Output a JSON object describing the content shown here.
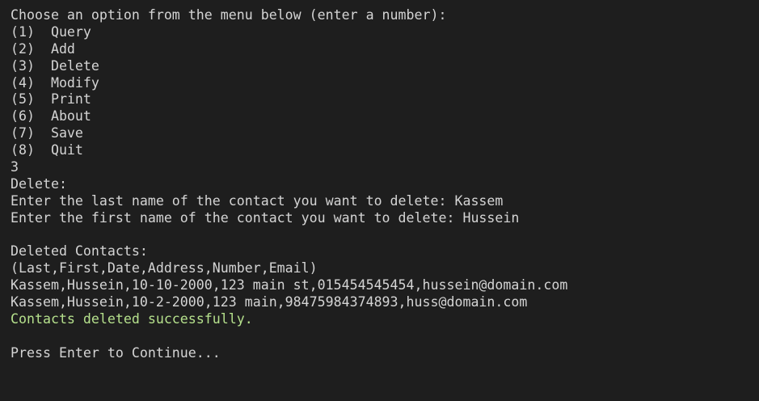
{
  "terminal": {
    "menu_prompt": "Choose an option from the menu below (enter a number):",
    "menu_items": [
      "(1)  Query",
      "(2)  Add",
      "(3)  Delete",
      "(4)  Modify",
      "(5)  Print",
      "(6)  About",
      "(7)  Save",
      "(8)  Quit"
    ],
    "user_choice": "3",
    "delete_header": "Delete:",
    "last_name_prompt": "Enter the last name of the contact you want to delete: Kassem",
    "first_name_prompt": "Enter the first name of the contact you want to delete: Hussein",
    "deleted_header": "Deleted Contacts:",
    "columns_line": "(Last,First,Date,Address,Number,Email)",
    "deleted_rows": [
      "Kassem,Hussein,10-10-2000,123 main st,015454545454,hussein@domain.com",
      "Kassem,Hussein,10-2-2000,123 main,98475984374893,huss@domain.com"
    ],
    "success_message": "Contacts deleted successfully.",
    "continue_prompt": "Press Enter to Continue...",
    "colors": {
      "background": "#1e1e1e",
      "text": "#d4d4d4",
      "success": "#b5e08c"
    }
  }
}
